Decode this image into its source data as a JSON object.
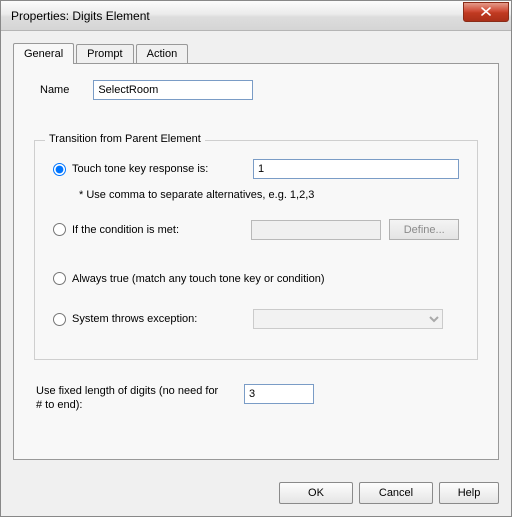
{
  "window": {
    "title": "Properties: Digits Element"
  },
  "tabs": {
    "general": "General",
    "prompt": "Prompt",
    "action": "Action"
  },
  "general": {
    "name_label": "Name",
    "name_value": "SelectRoom",
    "group_title": "Transition from Parent Element",
    "opt_touchtone": "Touch tone key response is:",
    "touchtone_value": "1",
    "touchtone_hint": "* Use comma to separate alternatives, e.g. 1,2,3",
    "opt_condition": "If the condition is met:",
    "condition_value": "",
    "define_label": "Define...",
    "opt_always": "Always true (match any touch tone key or condition)",
    "opt_exception": "System throws exception:",
    "exception_value": "",
    "fixed_label": "Use fixed length of digits (no need for # to end):",
    "fixed_value": "3"
  },
  "buttons": {
    "ok": "OK",
    "cancel": "Cancel",
    "help": "Help"
  }
}
